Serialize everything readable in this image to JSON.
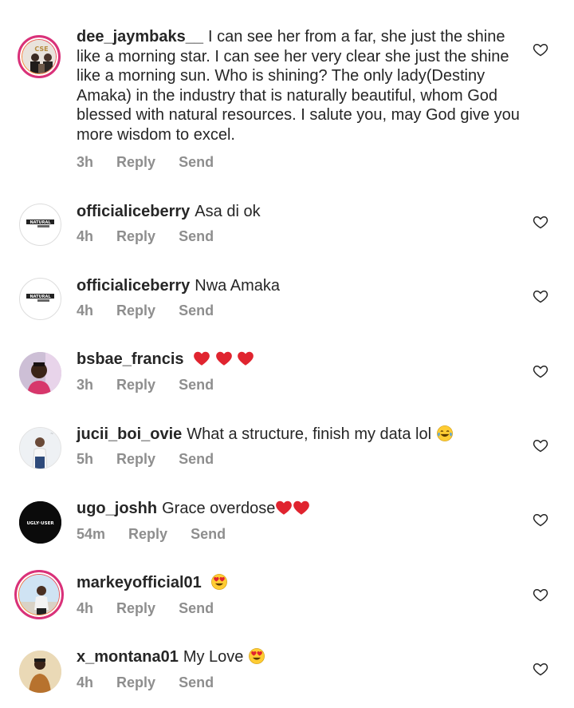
{
  "comments": [
    {
      "username": "dee_jaymbaks__",
      "text": "I can see her from a far, she just the shine like a morning star. I can see her very clear she just the shine like a morning sun. Who is shining? The only lady(Destiny Amaka) in the industry that is naturally beautiful, whom God blessed with natural resources. I salute you,  may God give you more wisdom to excel.",
      "time": "3h",
      "reply": "Reply",
      "send": "Send",
      "avatar": "group-photo-avatar"
    },
    {
      "username": "officialiceberry",
      "text": "Asa di ok",
      "time": "4h",
      "reply": "Reply",
      "send": "Send",
      "avatar": "logo-avatar"
    },
    {
      "username": "officialiceberry",
      "text": "Nwa Amaka",
      "time": "4h",
      "reply": "Reply",
      "send": "Send",
      "avatar": "logo-avatar"
    },
    {
      "username": "bsbae_francis",
      "text": "",
      "emojis": [
        "heart",
        "heart",
        "heart"
      ],
      "time": "3h",
      "reply": "Reply",
      "send": "Send",
      "avatar": "person-avatar"
    },
    {
      "username": "jucii_boi_ovie",
      "text": "What a structure, finish my data lol",
      "emojis": [
        "tears-of-joy"
      ],
      "time": "5h",
      "reply": "Reply",
      "send": "Send",
      "avatar": "person-avatar"
    },
    {
      "username": "ugo_joshh",
      "text": "Grace overdose",
      "emojis": [
        "heart",
        "heart"
      ],
      "time": "54m",
      "reply": "Reply",
      "send": "Send",
      "avatar": "dark-logo-avatar"
    },
    {
      "username": "markeyofficial01",
      "text": "",
      "emojis": [
        "heart-eyes"
      ],
      "time": "4h",
      "reply": "Reply",
      "send": "Send",
      "avatar": "person-avatar"
    },
    {
      "username": "x_montana01",
      "text": "My Love",
      "emojis": [
        "heart-eyes"
      ],
      "time": "4h",
      "reply": "Reply",
      "send": "Send",
      "avatar": "person-avatar"
    }
  ],
  "avatar_texts": {
    "iceberry_logo": "NATURAL",
    "ugo_logo": "UGLY·USER"
  },
  "colors": {
    "text": "#262626",
    "meta": "#8e8e8e",
    "heart_icon": "#262626",
    "emoji_heart": "#e0242f",
    "story_ring": "#d9317a"
  }
}
